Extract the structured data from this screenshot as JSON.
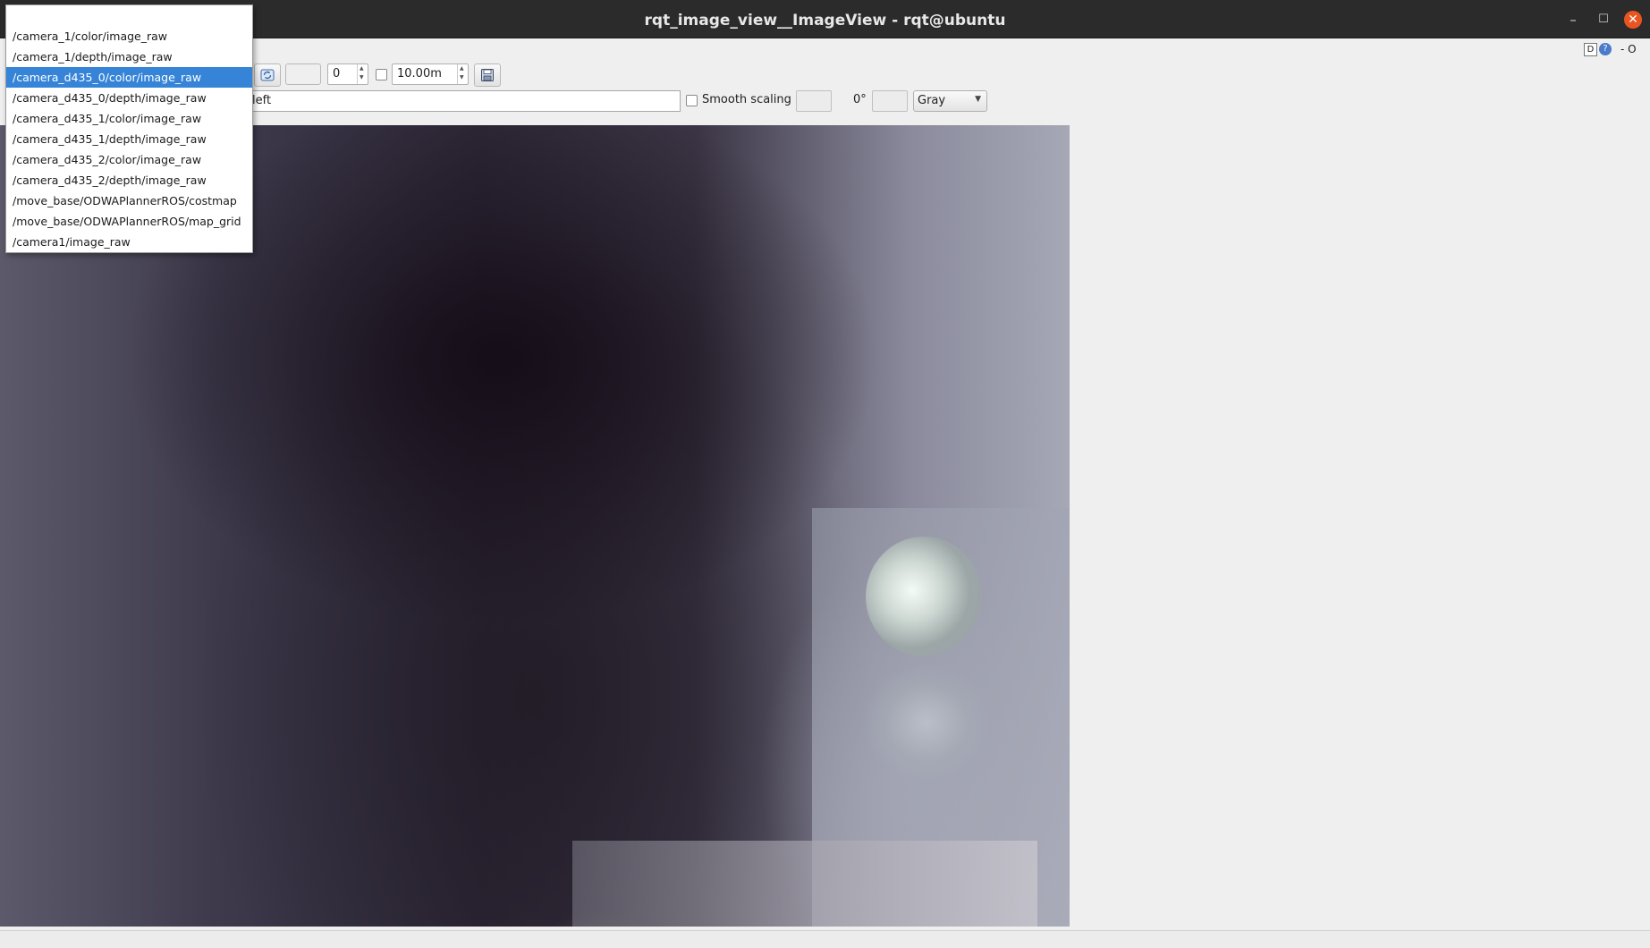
{
  "window": {
    "title": "rqt_image_view__ImageView - rqt@ubuntu",
    "minimize": "–",
    "maximize": "☐",
    "close": "✕"
  },
  "corner": {
    "dock_label": "D",
    "help_label": "?",
    "float_label": "- O"
  },
  "toolbar": {
    "spin_value": "0",
    "max_distance_value": "10.00m",
    "topic_text": "left",
    "smooth_scaling_label": "Smooth scaling",
    "smooth_scaling_checked": false,
    "rotation_label": "0°",
    "colormap_value": "Gray"
  },
  "topic_dropdown": {
    "selected_index": 3,
    "items": [
      "",
      "/camera_1/color/image_raw",
      "/camera_1/depth/image_raw",
      "/camera_d435_0/color/image_raw",
      "/camera_d435_0/depth/image_raw",
      "/camera_d435_1/color/image_raw",
      "/camera_d435_1/depth/image_raw",
      "/camera_d435_2/color/image_raw",
      "/camera_d435_2/depth/image_raw",
      "/move_base/ODWAPlannerROS/costmap",
      "/move_base/ODWAPlannerROS/map_grid",
      "/camera1/image_raw"
    ]
  },
  "colors": {
    "titlebar": "#2b2b2b",
    "selection": "#3584d8",
    "close_button": "#e95420"
  },
  "icons": {
    "refresh": "refresh-icon",
    "save": "save-icon",
    "help": "help-icon"
  }
}
